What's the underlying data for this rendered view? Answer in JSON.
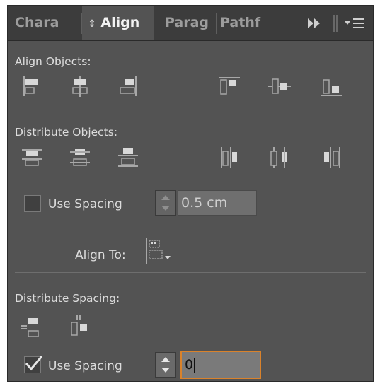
{
  "tabs": [
    {
      "label": "Chara",
      "active": false
    },
    {
      "label": "Align",
      "active": true
    },
    {
      "label": "Parag",
      "active": false
    },
    {
      "label": "Pathf",
      "active": false
    }
  ],
  "sections": {
    "align_objects": {
      "title": "Align Objects:",
      "buttons": [
        "align-left-edges",
        "align-horizontal-centers",
        "align-right-edges",
        "align-top-edges",
        "align-vertical-centers",
        "align-bottom-edges"
      ]
    },
    "distribute_objects": {
      "title": "Distribute Objects:",
      "buttons": [
        "distribute-top-edges",
        "distribute-vertical-centers",
        "distribute-bottom-edges",
        "distribute-left-edges",
        "distribute-horizontal-centers",
        "distribute-right-edges"
      ],
      "use_spacing": {
        "label": "Use Spacing",
        "checked": false,
        "value": "0.5 cm"
      },
      "align_to": {
        "label": "Align To:"
      }
    },
    "distribute_spacing": {
      "title": "Distribute Spacing:",
      "buttons": [
        "distribute-vertical-space",
        "distribute-horizontal-space"
      ],
      "use_spacing": {
        "label": "Use Spacing",
        "checked": true,
        "value": "0"
      }
    }
  },
  "colors": {
    "panel": "#535353",
    "tabbar": "#3c3c3c",
    "focus": "#d9822b",
    "icon_light": "#d8d8d8",
    "icon_dark": "#a8a8a8"
  }
}
